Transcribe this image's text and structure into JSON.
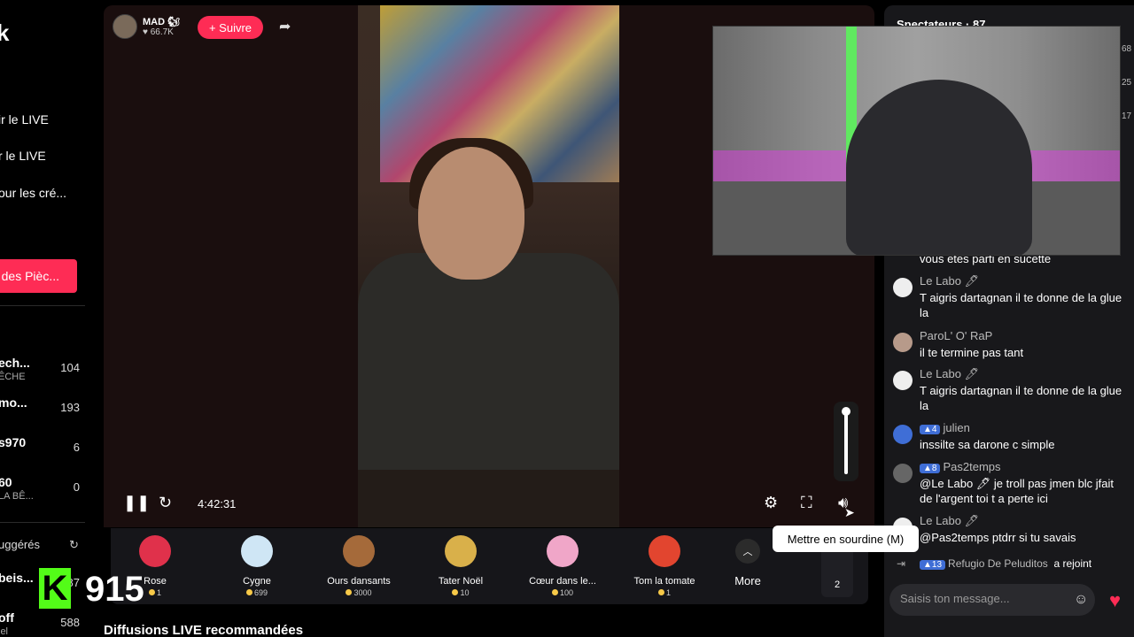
{
  "sidebar": {
    "logo": "k",
    "links": [
      "ir le LIVE",
      "r le LIVE",
      "our les cré..."
    ],
    "coins_button": "des Pièc...",
    "accounts": [
      {
        "name": "ech...",
        "sub": "ÊCHE",
        "count": "104"
      },
      {
        "name": "mo...",
        "sub": "",
        "count": "193"
      },
      {
        "name": "s970",
        "sub": "",
        "count": "6"
      },
      {
        "name": "60",
        "sub": "LA BÊ...",
        "count": "0"
      }
    ],
    "suggested_label": "uggérés",
    "more_accounts": [
      {
        "name": "beis...",
        "count": "87"
      },
      {
        "name": "off",
        "sub": "iel",
        "count": "588"
      }
    ]
  },
  "player": {
    "streamer": {
      "name": "MAD 🐿",
      "likes": "66.7K"
    },
    "follow_label": "+ Suivre",
    "time": "4:42:31"
  },
  "gifts": [
    {
      "name": "Rose",
      "price": "1",
      "color": "#e0314b"
    },
    {
      "name": "Cygne",
      "price": "699",
      "color": "#cfe6f5"
    },
    {
      "name": "Ours dansants",
      "price": "3000",
      "color": "#a56a3a"
    },
    {
      "name": "Tater Noël",
      "price": "10",
      "color": "#d9b04a"
    },
    {
      "name": "Cœur dans le...",
      "price": "100",
      "color": "#f0a6c8"
    },
    {
      "name": "Tom la tomate",
      "price": "1",
      "color": "#e2452f"
    }
  ],
  "gift_more_label": "More",
  "gift_count": "2",
  "recommend_title": "Diffusions LIVE recommandées",
  "kick_badge": {
    "letter": "K",
    "number": "915"
  },
  "chat": {
    "viewers": "Spectateurs · 87",
    "messages": [
      {
        "user": "",
        "text": "vous etes parti en sucette"
      },
      {
        "user": "Le Labo 🖊",
        "text": "T aigris dartagnan il te donne de la glue la"
      },
      {
        "user": "ParoL' O' RaP",
        "text": "il te termine pas tant"
      },
      {
        "user": "Le Labo 🖊",
        "text": "T aigris dartagnan il te donne de la glue la"
      },
      {
        "user": "julien",
        "level": "4",
        "text": "inssilte sa darone c simple"
      },
      {
        "user": "Pas2temps",
        "level": "8",
        "text": "@Le Labo 🖊 je troll pas jmen blc jfait de l'argent toi t a perte ici"
      },
      {
        "user": "Le Labo 🖊",
        "text": "@Pas2temps ptdrr si tu savais"
      }
    ],
    "join": {
      "level": "13",
      "user": "Refugio De Peluditos",
      "action": "a rejoint"
    },
    "input_placeholder": "Saisis ton message..."
  },
  "cam_nums": [
    "68",
    "25",
    "17"
  ],
  "tooltip": "Mettre en sourdine (M)"
}
